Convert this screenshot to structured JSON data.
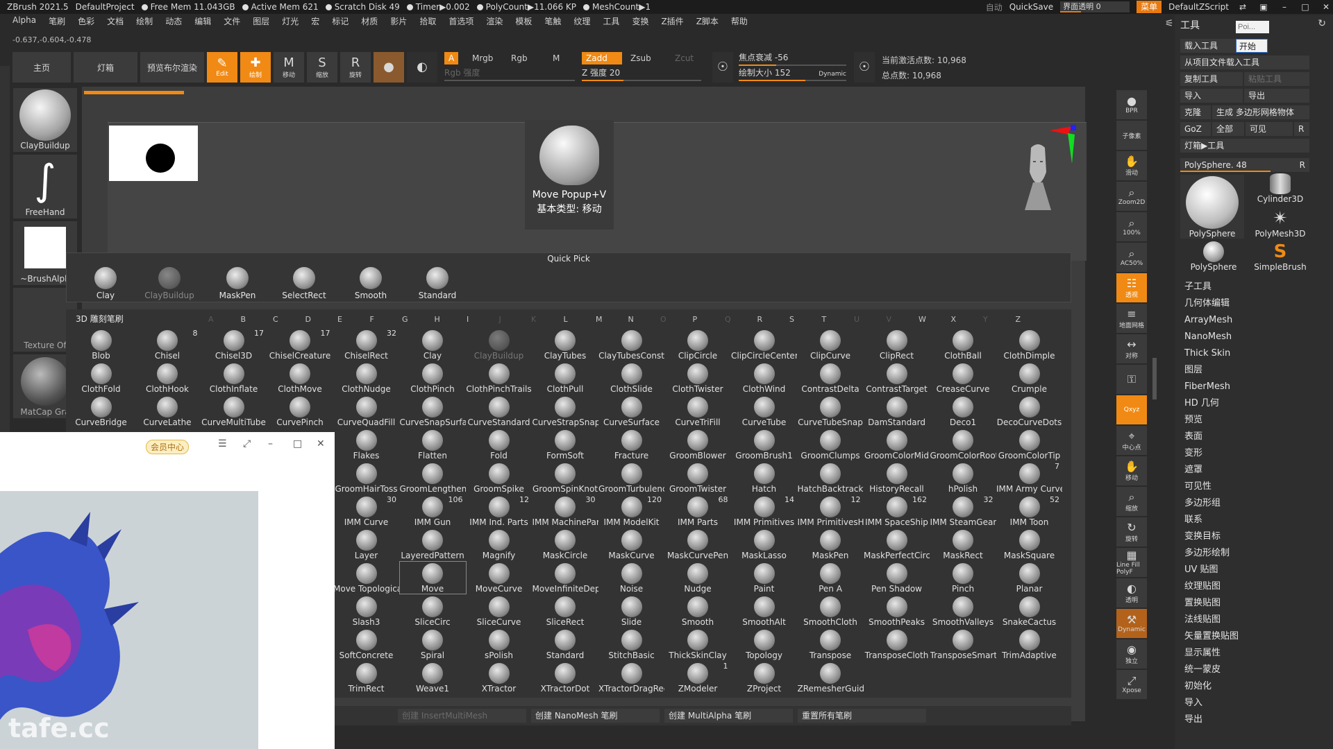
{
  "titlebar": {
    "app": "ZBrush 2021.5",
    "project": "DefaultProject",
    "free_mem": "Free Mem 11.043GB",
    "active_mem": "Active Mem 621",
    "scratch": "Scratch Disk 49",
    "timer": "Timer▶0.002",
    "polycount": "PolyCount▶11.066 KP",
    "meshcount": "MeshCount▶1",
    "auto": "自动",
    "quicksave": "QuickSave",
    "transparency": "界面透明 0",
    "menu": "菜单",
    "script": "DefaultZScript"
  },
  "menubar": [
    "Alpha",
    "笔刷",
    "色彩",
    "文档",
    "绘制",
    "动态",
    "编辑",
    "文件",
    "图层",
    "灯光",
    "宏",
    "标记",
    "材质",
    "影片",
    "拾取",
    "首选项",
    "渲染",
    "模板",
    "笔触",
    "纹理",
    "工具",
    "变换",
    "Z插件",
    "Z脚本",
    "帮助"
  ],
  "coords": "-0.637,-0.604,-0.478",
  "toolbar": {
    "home": "主页",
    "lightbox": "灯箱",
    "preview_bool": "预览布尔渲染",
    "edit": "Edit",
    "draw": "绘制",
    "move": "移动",
    "scale": "缩放",
    "rotate": "旋转",
    "a": "A",
    "mrgb": "Mrgb",
    "rgb": "Rgb",
    "m": "M",
    "zadd": "Zadd",
    "zsub": "Zsub",
    "zcut": "Zcut",
    "rgb_intensity": "Rgb 强度",
    "z_intensity": "Z 强度 20",
    "focal": "焦点衰减 -56",
    "draw_size": "绘制大小 152",
    "dynamic": "Dynamic",
    "active_points": "当前激活点数: 10,968",
    "total_points": "总点数: 10,968"
  },
  "left_panel": [
    {
      "label": "ClayBuildup"
    },
    {
      "label": "FreeHand"
    },
    {
      "label": "~BrushAlph"
    },
    {
      "label": "Texture Of"
    },
    {
      "label": "MatCap Gra"
    }
  ],
  "popup": {
    "line1": "Move Popup+V",
    "line2": "基本类型: 移动"
  },
  "quickpick": {
    "title": "Quick Pick",
    "items": [
      {
        "name": "Clay",
        "dim": false
      },
      {
        "name": "ClayBuildup",
        "dim": true
      },
      {
        "name": "MaskPen",
        "dim": false
      },
      {
        "name": "SelectRect",
        "dim": false
      },
      {
        "name": "Smooth",
        "dim": false
      },
      {
        "name": "Standard",
        "dim": false
      }
    ]
  },
  "brushgrid": {
    "title": "3D 雕刻笔刷",
    "letters": [
      {
        "l": "A",
        "dim": true
      },
      {
        "l": "B",
        "dim": false
      },
      {
        "l": "C",
        "dim": false
      },
      {
        "l": "D",
        "dim": false
      },
      {
        "l": "E",
        "dim": false
      },
      {
        "l": "F",
        "dim": false
      },
      {
        "l": "G",
        "dim": false
      },
      {
        "l": "H",
        "dim": false
      },
      {
        "l": "I",
        "dim": false
      },
      {
        "l": "J",
        "dim": true
      },
      {
        "l": "K",
        "dim": true
      },
      {
        "l": "L",
        "dim": false
      },
      {
        "l": "M",
        "dim": false
      },
      {
        "l": "N",
        "dim": false
      },
      {
        "l": "O",
        "dim": true
      },
      {
        "l": "P",
        "dim": false
      },
      {
        "l": "Q",
        "dim": true
      },
      {
        "l": "R",
        "dim": false
      },
      {
        "l": "S",
        "dim": false
      },
      {
        "l": "T",
        "dim": false
      },
      {
        "l": "U",
        "dim": true
      },
      {
        "l": "V",
        "dim": true
      },
      {
        "l": "W",
        "dim": false
      },
      {
        "l": "X",
        "dim": false
      },
      {
        "l": "Y",
        "dim": true
      },
      {
        "l": "Z",
        "dim": false
      }
    ],
    "rows": [
      [
        {
          "n": "Blob"
        },
        {
          "n": "Chisel",
          "c": "8"
        },
        {
          "n": "Chisel3D",
          "c": "17"
        },
        {
          "n": "ChiselCreature",
          "c": "17"
        },
        {
          "n": "ChiselRect",
          "c": "32"
        },
        {
          "n": "Clay"
        },
        {
          "n": "ClayBuildup",
          "dim": true
        },
        {
          "n": "ClayTubes"
        },
        {
          "n": "ClayTubesConst"
        },
        {
          "n": "ClipCircle"
        },
        {
          "n": "ClipCircleCenter"
        },
        {
          "n": "ClipCurve"
        },
        {
          "n": "ClipRect"
        },
        {
          "n": "ClothBall"
        },
        {
          "n": "ClothDimple"
        }
      ],
      [
        {
          "n": "ClothFold"
        },
        {
          "n": "ClothHook"
        },
        {
          "n": "ClothInflate"
        },
        {
          "n": "ClothMove"
        },
        {
          "n": "ClothNudge"
        },
        {
          "n": "ClothPinch"
        },
        {
          "n": "ClothPinchTrails"
        },
        {
          "n": "ClothPull"
        },
        {
          "n": "ClothSlide"
        },
        {
          "n": "ClothTwister"
        },
        {
          "n": "ClothWind"
        },
        {
          "n": "ContrastDelta"
        },
        {
          "n": "ContrastTarget"
        },
        {
          "n": "CreaseCurve"
        },
        {
          "n": "Crumple"
        }
      ],
      [
        {
          "n": "CurveBridge"
        },
        {
          "n": "CurveLathe"
        },
        {
          "n": "CurveMultiTube"
        },
        {
          "n": "CurvePinch"
        },
        {
          "n": "CurveQuadFill"
        },
        {
          "n": "CurveSnapSurface"
        },
        {
          "n": "CurveStandard"
        },
        {
          "n": "CurveStrapSnap"
        },
        {
          "n": "CurveSurface"
        },
        {
          "n": "CurveTriFill"
        },
        {
          "n": "CurveTube"
        },
        {
          "n": "CurveTubeSnap"
        },
        {
          "n": "DamStandard"
        },
        {
          "n": "Deco1"
        },
        {
          "n": "DecoCurveDots"
        }
      ],
      [
        {
          "n": "Flakes"
        },
        {
          "n": "Flatten"
        },
        {
          "n": "Fold"
        },
        {
          "n": "FormSoft"
        },
        {
          "n": "Fracture"
        },
        {
          "n": "GroomBlower"
        },
        {
          "n": "GroomBrush1"
        },
        {
          "n": "GroomClumps"
        },
        {
          "n": "GroomColorMid"
        },
        {
          "n": "GroomColorRoot"
        },
        {
          "n": "GroomColorTip"
        }
      ],
      [
        {
          "n": "GroomHairToss"
        },
        {
          "n": "GroomLengthen"
        },
        {
          "n": "GroomSpike"
        },
        {
          "n": "GroomSpinKnot"
        },
        {
          "n": "GroomTurbulence"
        },
        {
          "n": "GroomTwister"
        },
        {
          "n": "Hatch"
        },
        {
          "n": "HatchBacktrack"
        },
        {
          "n": "HistoryRecall"
        },
        {
          "n": "hPolish"
        },
        {
          "n": "IMM Army Curve",
          "c": "7"
        }
      ],
      [
        {
          "n": "IMM Curve",
          "c": "30"
        },
        {
          "n": "IMM Gun",
          "c": "106"
        },
        {
          "n": "IMM Ind. Parts",
          "c": "12"
        },
        {
          "n": "IMM MachinePart",
          "c": "30"
        },
        {
          "n": "IMM ModelKit",
          "c": "120"
        },
        {
          "n": "IMM Parts",
          "c": "68"
        },
        {
          "n": "IMM Primitives",
          "c": "14"
        },
        {
          "n": "IMM PrimitivesH",
          "c": "12"
        },
        {
          "n": "IMM SpaceShip",
          "c": "162"
        },
        {
          "n": "IMM SteamGears",
          "c": "32"
        },
        {
          "n": "IMM Toon",
          "c": "52"
        }
      ],
      [
        {
          "n": "Layer"
        },
        {
          "n": "LayeredPattern"
        },
        {
          "n": "Magnify"
        },
        {
          "n": "MaskCircle"
        },
        {
          "n": "MaskCurve"
        },
        {
          "n": "MaskCurvePen"
        },
        {
          "n": "MaskLasso"
        },
        {
          "n": "MaskPen"
        },
        {
          "n": "MaskPerfectCircle"
        },
        {
          "n": "MaskRect"
        },
        {
          "n": "MaskSquare"
        }
      ],
      [
        {
          "n": "Move Topological"
        },
        {
          "n": "Move",
          "sel": true
        },
        {
          "n": "MoveCurve"
        },
        {
          "n": "MoveInfiniteDepth"
        },
        {
          "n": "Noise"
        },
        {
          "n": "Nudge"
        },
        {
          "n": "Paint"
        },
        {
          "n": "Pen A"
        },
        {
          "n": "Pen Shadow"
        },
        {
          "n": "Pinch"
        },
        {
          "n": "Planar"
        }
      ],
      [
        {
          "n": "Slash3"
        },
        {
          "n": "SliceCirc"
        },
        {
          "n": "SliceCurve"
        },
        {
          "n": "SliceRect"
        },
        {
          "n": "Slide"
        },
        {
          "n": "Smooth"
        },
        {
          "n": "SmoothAlt"
        },
        {
          "n": "SmoothCloth"
        },
        {
          "n": "SmoothPeaks"
        },
        {
          "n": "SmoothValleys"
        },
        {
          "n": "SnakeCactus"
        }
      ],
      [
        {
          "n": "SoftConcrete"
        },
        {
          "n": "Spiral"
        },
        {
          "n": "sPolish"
        },
        {
          "n": "Standard"
        },
        {
          "n": "StitchBasic"
        },
        {
          "n": "ThickSkinClay"
        },
        {
          "n": "Topology"
        },
        {
          "n": "Transpose"
        },
        {
          "n": "TransposeCloth"
        },
        {
          "n": "TransposeSmart"
        },
        {
          "n": "TrimAdaptive"
        }
      ],
      [
        {
          "n": "TrimRect"
        },
        {
          "n": "Weave1"
        },
        {
          "n": "XTractor"
        },
        {
          "n": "XTractorDot"
        },
        {
          "n": "XTractorDragRect"
        },
        {
          "n": "ZModeler",
          "c": "1"
        },
        {
          "n": "ZProject"
        },
        {
          "n": "ZRemesherGuide"
        }
      ]
    ]
  },
  "brush_footer": [
    {
      "label": "创建 InsertMultiMesh",
      "dim": true
    },
    {
      "label": "创建 NanoMesh 笔刷",
      "dim": false
    },
    {
      "label": "创建 MultiAlpha 笔刷",
      "dim": false
    },
    {
      "label": "重置所有笔刷",
      "dim": false
    }
  ],
  "overlay": {
    "vip": "会员中心",
    "watermark": "tafe.cc"
  },
  "right_icons": [
    {
      "label": "BPR",
      "glyph": "●"
    },
    {
      "label": "子像素",
      "glyph": ""
    },
    {
      "label": "滑动",
      "glyph": "✋"
    },
    {
      "label": "Zoom2D",
      "glyph": "⌕"
    },
    {
      "label": "100%",
      "glyph": "⌕"
    },
    {
      "label": "AC50%",
      "glyph": "⌕"
    },
    {
      "label": "透视",
      "glyph": "☷",
      "orange": true
    },
    {
      "label": "地面网格",
      "glyph": "≡"
    },
    {
      "label": "对称",
      "glyph": "↔"
    },
    {
      "label": "",
      "glyph": "⚿"
    },
    {
      "label": "Qxyz",
      "glyph": "",
      "orange": true
    },
    {
      "label": "中心点",
      "glyph": "⌖"
    },
    {
      "label": "移动",
      "glyph": "✋"
    },
    {
      "label": "缩放",
      "glyph": "⌕"
    },
    {
      "label": "旋转",
      "glyph": "↻"
    },
    {
      "label": "Line Fill PolyF",
      "glyph": "▦"
    },
    {
      "label": "透明",
      "glyph": "◐"
    },
    {
      "label": "Dynamic",
      "glyph": "⚒",
      "brown": true
    },
    {
      "label": "独立",
      "glyph": "◉"
    },
    {
      "label": "Xpose",
      "glyph": "⤢"
    }
  ],
  "rpanel": {
    "title": "工具",
    "search_placeholder": "Poi...",
    "start": "开始",
    "load_tool": "载入工具",
    "load_project": "从项目文件载入工具",
    "copy_tool": "复制工具",
    "paste_tool": "粘贴工具",
    "import": "导入",
    "export": "导出",
    "clone": "克隆",
    "make_polymesh": "生成 多边形网格物体",
    "goz": "GoZ",
    "all": "全部",
    "visible": "可见",
    "r": "R",
    "lightbox_tool": "灯箱▶工具",
    "polysphere_slider": "PolySphere. 48",
    "thumbs": [
      {
        "name": "PolySphere"
      },
      {
        "name": "Cylinder3D"
      },
      {
        "name": "PolyMesh3D"
      },
      {
        "name": "PolySphere"
      },
      {
        "name": "SimpleBrush"
      }
    ],
    "list": [
      "子工具",
      "几何体编辑",
      "ArrayMesh",
      "NanoMesh",
      "Thick Skin",
      "图层",
      "FiberMesh",
      "HD 几何",
      "预览",
      "表面",
      "变形",
      "遮罩",
      "可见性",
      "多边形组",
      "联系",
      "变换目标",
      "多边形绘制",
      "UV 贴图",
      "纹理贴图",
      "置换贴图",
      "法线贴图",
      "矢量置换贴图",
      "显示属性",
      "统一蒙皮",
      "初始化",
      "导入",
      "导出"
    ]
  }
}
